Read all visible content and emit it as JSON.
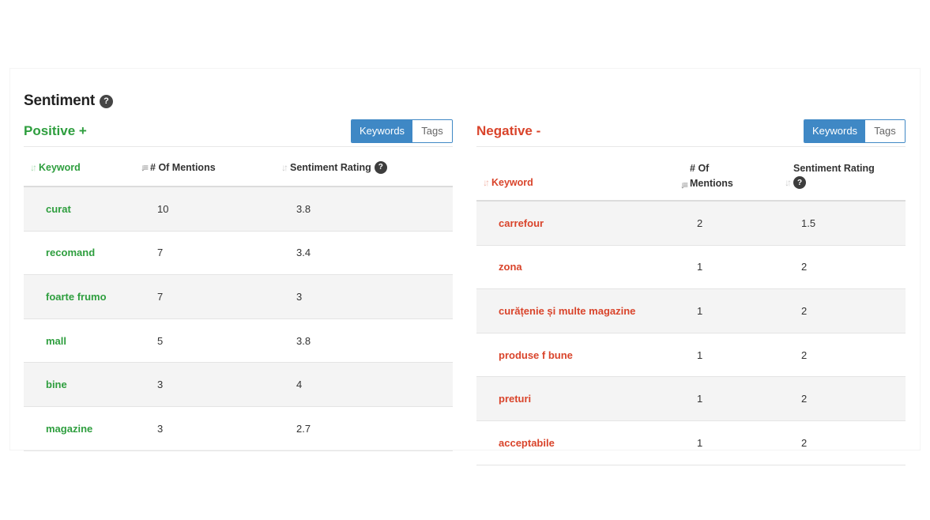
{
  "section": {
    "title": "Sentiment",
    "help": "?"
  },
  "positive": {
    "title": "Positive +",
    "toggle": {
      "active": "Keywords",
      "inactive": "Tags"
    },
    "headers": {
      "keyword": "Keyword",
      "mentions": "# Of Mentions",
      "rating": "Sentiment Rating",
      "help": "?"
    },
    "rows": [
      {
        "keyword": "curat",
        "mentions": "10",
        "rating": "3.8"
      },
      {
        "keyword": "recomand",
        "mentions": "7",
        "rating": "3.4"
      },
      {
        "keyword": "foarte frumo",
        "mentions": "7",
        "rating": "3"
      },
      {
        "keyword": "mall",
        "mentions": "5",
        "rating": "3.8"
      },
      {
        "keyword": "bine",
        "mentions": "3",
        "rating": "4"
      },
      {
        "keyword": "magazine",
        "mentions": "3",
        "rating": "2.7"
      }
    ]
  },
  "negative": {
    "title": "Negative -",
    "toggle": {
      "active": "Keywords",
      "inactive": "Tags"
    },
    "headers": {
      "keyword": "Keyword",
      "mentions_line1": "# Of",
      "mentions_line2": "Mentions",
      "rating": "Sentiment Rating",
      "help": "?"
    },
    "rows": [
      {
        "keyword": "carrefour",
        "mentions": "2",
        "rating": "1.5"
      },
      {
        "keyword": "zona",
        "mentions": "1",
        "rating": "2"
      },
      {
        "keyword": "curățenie și multe magazine",
        "mentions": "1",
        "rating": "2"
      },
      {
        "keyword": "produse f bune",
        "mentions": "1",
        "rating": "2"
      },
      {
        "keyword": "preturi",
        "mentions": "1",
        "rating": "2"
      },
      {
        "keyword": "acceptabile",
        "mentions": "1",
        "rating": "2"
      }
    ]
  },
  "colors": {
    "positive": "#2e9e3e",
    "negative": "#d9442b",
    "accent": "#3f88c5"
  }
}
